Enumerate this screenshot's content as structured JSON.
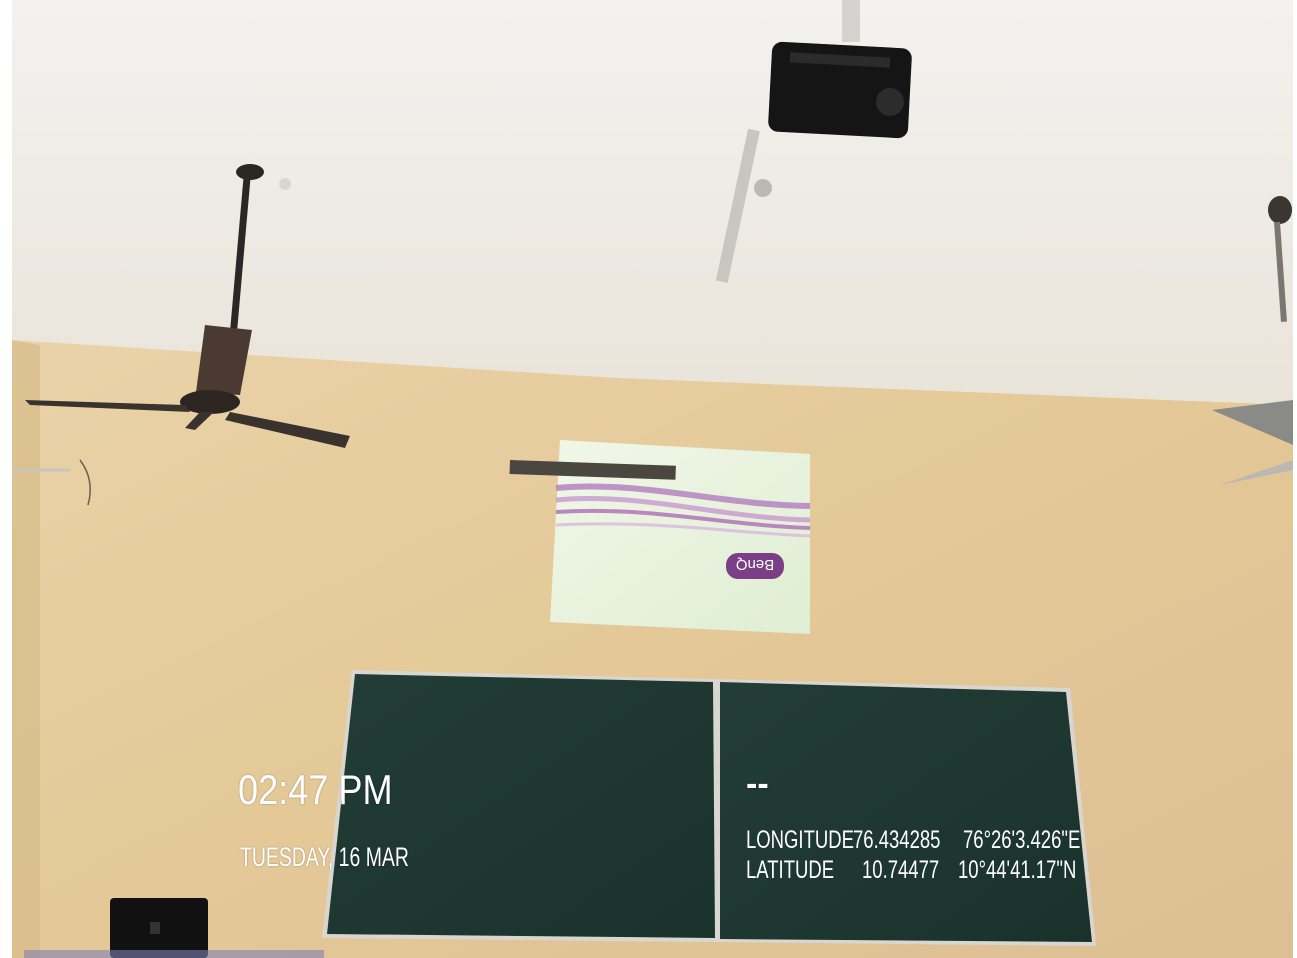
{
  "scene": {
    "description_colors": {
      "ceiling": "#f2efe9",
      "wall": "#e6c99a",
      "blackboard": "#1f3a33",
      "screen": "#e9f3de",
      "benq_logo": "#7a3f86"
    },
    "projected_logo_text": "BenQ"
  },
  "overlay": {
    "time": "02:47 PM",
    "date": "TUESDAY, 16 MAR",
    "placeholder": "--",
    "longitude_label": "LONGITUDE",
    "longitude_decimal": "76.434285",
    "longitude_dms": "76°26'3.426\"E",
    "latitude_label": "LATITUDE",
    "latitude_decimal": "10.74477",
    "latitude_dms": "10°44'41.17\"N"
  }
}
